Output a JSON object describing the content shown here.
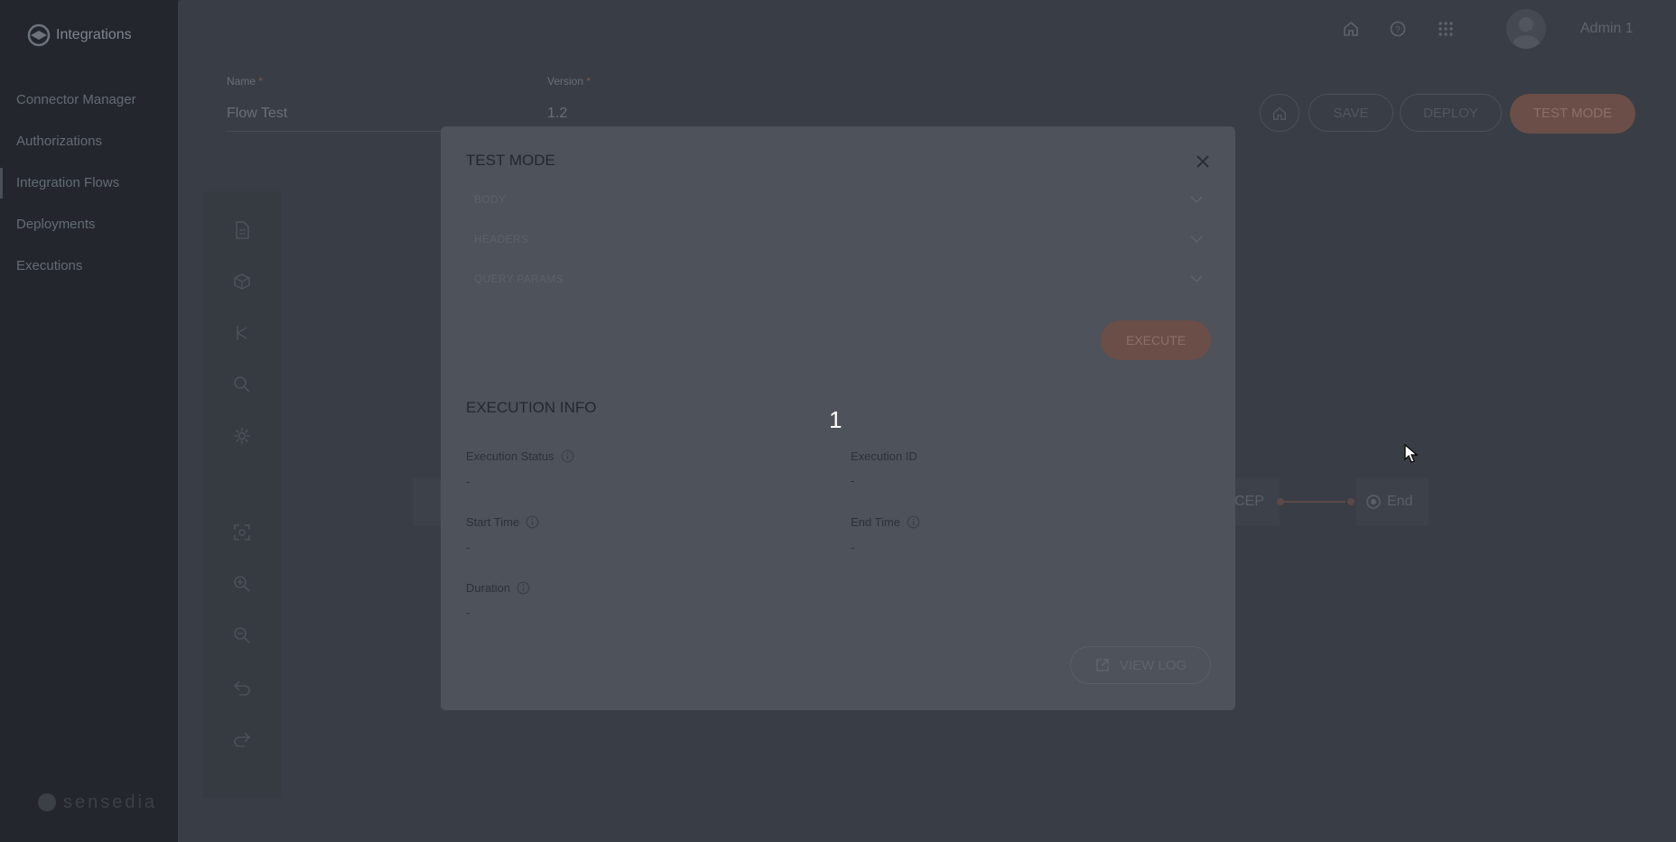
{
  "app": {
    "name": "Integrations",
    "footer_brand": "sensedia"
  },
  "sidebar": {
    "items": [
      {
        "label": "Connector Manager"
      },
      {
        "label": "Authorizations"
      },
      {
        "label": "Integration Flows"
      },
      {
        "label": "Deployments"
      },
      {
        "label": "Executions"
      }
    ]
  },
  "header": {
    "user_name": "Admin 1"
  },
  "form": {
    "name_label": "Name",
    "name_value": "Flow Test",
    "version_label": "Version",
    "version_value": "1.2",
    "required_mark": "*"
  },
  "toolbar": {
    "save_label": "SAVE",
    "deploy_label": "DEPLOY",
    "test_mode_label": "TEST MODE"
  },
  "canvas": {
    "node_cep": "CEP",
    "node_end": "End"
  },
  "modal": {
    "title": "TEST MODE",
    "sections": [
      {
        "label": "BODY"
      },
      {
        "label": "HEADERS"
      },
      {
        "label": "QUERY PARAMS"
      }
    ],
    "execute_label": "EXECUTE",
    "execution_info_title": "EXECUTION INFO",
    "fields": {
      "status_label": "Execution Status",
      "status_value": "-",
      "id_label": "Execution ID",
      "id_value": "-",
      "start_label": "Start Time",
      "start_value": "-",
      "end_label": "End Time",
      "end_value": "-",
      "duration_label": "Duration",
      "duration_value": "-"
    },
    "view_log_label": "VIEW LOG"
  },
  "overlay_marker": "1",
  "colors": {
    "accent": "#6b4e47",
    "sidebar_bg": "#23272d",
    "main_bg": "#393d45",
    "modal_bg": "#4e525a"
  }
}
